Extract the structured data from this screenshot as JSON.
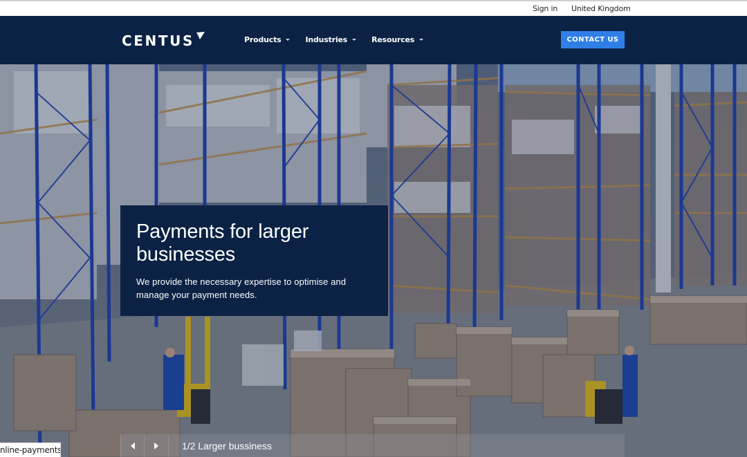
{
  "utility_bar": {
    "sign_in": "Sign in",
    "region": "United Kingdom"
  },
  "header": {
    "logo_text": "CENTUS",
    "logo_icon": "arrow-flag-icon",
    "nav": [
      {
        "label": "Products",
        "icon": "caret-down-icon"
      },
      {
        "label": "Industries",
        "icon": "caret-down-icon"
      },
      {
        "label": "Resources",
        "icon": "caret-down-icon"
      }
    ],
    "cta_label": "CONTACT US"
  },
  "hero": {
    "image_description": "Warehouse with blue pallet racking, stacked cardboard boxes and workers on yellow pallet trucks",
    "title": "Payments for larger businesses",
    "description": "We provide the necessary expertise to optimise and manage your payment needs.",
    "carousel": {
      "prev_icon": "arrow-left-icon",
      "next_icon": "arrow-right-icon",
      "current": 1,
      "total": 2,
      "label": "1/2 Larger bussiness"
    }
  },
  "status_bar": {
    "link_preview": "nline-payments"
  },
  "colors": {
    "navy": "#0b2244",
    "cta_blue": "#2f7fe6",
    "white": "#ffffff"
  }
}
